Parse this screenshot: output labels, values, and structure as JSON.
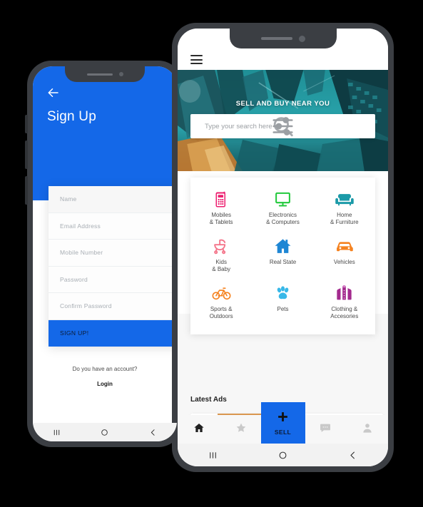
{
  "signup_screen": {
    "back_icon": "arrow-left-icon",
    "title": "Sign Up",
    "fields": [
      {
        "placeholder": "Name",
        "name": "name-field"
      },
      {
        "placeholder": "Email Address",
        "name": "email-field"
      },
      {
        "placeholder": "Mobile Number",
        "name": "mobile-number-field"
      },
      {
        "placeholder": "Password",
        "name": "password-field"
      },
      {
        "placeholder": "Confirm Password",
        "name": "confirm-password-field"
      }
    ],
    "submit_label": "SIGN UP!",
    "have_account_text": "Do you have an account?",
    "login_label": "Login",
    "accent_color": "#1468e8"
  },
  "home_screen": {
    "menu_icon": "hamburger-menu-icon",
    "banner_title": "SELL AND BUY NEAR YOU",
    "search": {
      "placeholder": "Type your search here",
      "search_icon": "search-icon",
      "filter_icon": "sliders-filter-icon"
    },
    "categories": [
      {
        "label_line1": "Mobiles",
        "label_line2": "& Tablets",
        "icon": "mobile-phone-icon",
        "color": "#ec1e6f"
      },
      {
        "label_line1": "Electronics",
        "label_line2": "& Computers",
        "icon": "monitor-icon",
        "color": "#22c93c"
      },
      {
        "label_line1": "Home",
        "label_line2": "& Furniture",
        "icon": "sofa-icon",
        "color": "#1b9aa8"
      },
      {
        "label_line1": "Kids",
        "label_line2": "& Baby",
        "icon": "stroller-icon",
        "color": "#f4748a"
      },
      {
        "label_line1": "Real State",
        "label_line2": "",
        "icon": "house-icon",
        "color": "#1e86d4"
      },
      {
        "label_line1": "Vehicles",
        "label_line2": "",
        "icon": "car-icon",
        "color": "#f5821f"
      },
      {
        "label_line1": "Sports &",
        "label_line2": "Outdoors",
        "icon": "bicycle-icon",
        "color": "#f5821f"
      },
      {
        "label_line1": "Pets",
        "label_line2": "",
        "icon": "paw-icon",
        "color": "#38b8e8"
      },
      {
        "label_line1": "Clothing &",
        "label_line2": "Accesories",
        "icon": "jacket-icon",
        "color": "#a32a8e"
      }
    ],
    "latest_ads_title": "Latest Ads",
    "bottom_nav": [
      {
        "name": "nav-home",
        "icon": "home-icon",
        "active": true
      },
      {
        "name": "nav-favorites",
        "icon": "star-icon",
        "active": false
      },
      {
        "name": "nav-chat",
        "icon": "chat-bubble-icon",
        "active": false
      },
      {
        "name": "nav-profile",
        "icon": "person-icon",
        "active": false
      }
    ],
    "sell_button": {
      "label": "SELL",
      "icon": "plus-icon",
      "color": "#1468e8"
    }
  },
  "android_nav": {
    "recents_icon": "recents-icon",
    "home_icon": "home-circle-icon",
    "back_icon": "back-chevron-icon"
  }
}
